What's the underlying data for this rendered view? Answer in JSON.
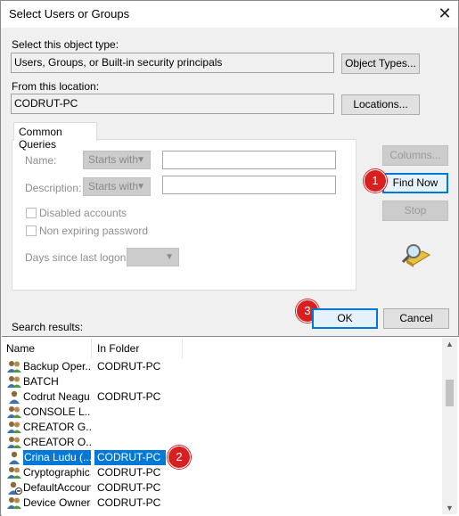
{
  "window": {
    "title": "Select Users or Groups"
  },
  "object_type": {
    "label": "Select this object type:",
    "value": "Users, Groups, or Built-in security principals",
    "button": "Object Types..."
  },
  "location": {
    "label": "From this location:",
    "value": "CODRUT-PC",
    "button": "Locations..."
  },
  "queries": {
    "tab": "Common Queries",
    "name_label": "Name:",
    "name_mode": "Starts with",
    "desc_label": "Description:",
    "desc_mode": "Starts with",
    "disabled_label": "Disabled accounts",
    "nonexp_label": "Non expiring password",
    "days_label": "Days since last logon:"
  },
  "side_buttons": {
    "columns": "Columns...",
    "find_now": "Find Now",
    "stop": "Stop"
  },
  "dialog_buttons": {
    "ok": "OK",
    "cancel": "Cancel"
  },
  "badges": {
    "find": "1",
    "row": "2",
    "ok": "3"
  },
  "results": {
    "label": "Search results:",
    "columns": [
      "Name",
      "In Folder"
    ],
    "rows": [
      {
        "name": "Backup Oper...",
        "folder": "CODRUT-PC",
        "icon": "group"
      },
      {
        "name": "BATCH",
        "folder": "",
        "icon": "group"
      },
      {
        "name": "Codrut Neagu...",
        "folder": "CODRUT-PC",
        "icon": "user"
      },
      {
        "name": "CONSOLE L...",
        "folder": "",
        "icon": "group"
      },
      {
        "name": "CREATOR G...",
        "folder": "",
        "icon": "group"
      },
      {
        "name": "CREATOR O...",
        "folder": "",
        "icon": "group"
      },
      {
        "name": "Crina Ludu (...",
        "folder": "CODRUT-PC",
        "icon": "user"
      },
      {
        "name": "Cryptographic...",
        "folder": "CODRUT-PC",
        "icon": "group"
      },
      {
        "name": "DefaultAccount",
        "folder": "CODRUT-PC",
        "icon": "user-disabled"
      },
      {
        "name": "Device Owners",
        "folder": "CODRUT-PC",
        "icon": "group"
      }
    ]
  },
  "colors": {
    "accent": "#0078d7",
    "badge": "#d82020"
  }
}
